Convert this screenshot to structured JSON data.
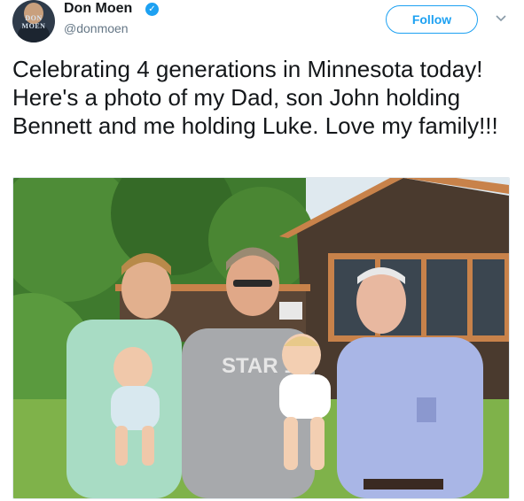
{
  "user": {
    "name": "Don Moen",
    "handle": "@donmoen",
    "verified": true,
    "avatar_text": "DON MOEN"
  },
  "actions": {
    "follow_label": "Follow",
    "more_icon": "chevron-down-icon"
  },
  "tweet": {
    "text": "Celebrating 4 generations in Minnesota today! Here's a photo of my Dad, son John holding Bennett and me holding Luke. Love my family!!!"
  },
  "photo": {
    "shirt_text": "STAR 19",
    "palette": {
      "grass": "#7fb24a",
      "trees": "#3f7a2e",
      "cabin": "#4a3a2e",
      "trim": "#c8824a",
      "link": "#1da1f2"
    }
  }
}
